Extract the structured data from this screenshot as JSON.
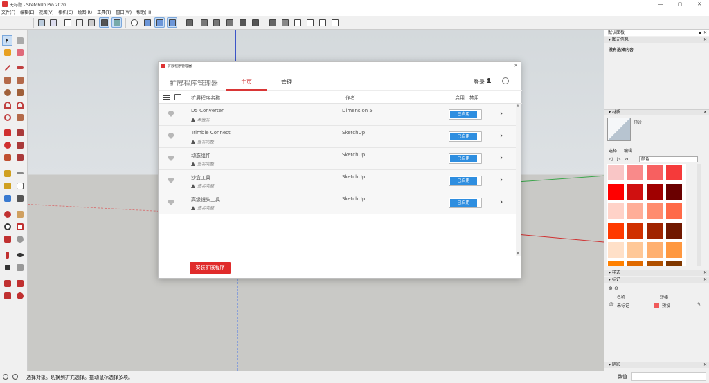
{
  "window": {
    "title": "无标题 - SketchUp Pro 2020",
    "controls": [
      "—",
      "▢",
      "✕"
    ]
  },
  "menu": [
    "文件(F)",
    "编辑(E)",
    "视图(V)",
    "相机(C)",
    "绘图(R)",
    "工具(T)",
    "窗口(W)",
    "帮助(H)"
  ],
  "dialog": {
    "title": "扩展程序管理器",
    "close": "✕",
    "app_name": "扩展程序管理器",
    "tabs": [
      "主页",
      "管理"
    ],
    "active_tab": "主页",
    "login": "登录",
    "columns": {
      "name": "扩展程序名称",
      "author": "作者",
      "status": "启用 | 禁用"
    },
    "extensions": [
      {
        "name": "D5 Converter",
        "signature": "未签名",
        "author": "Dimension 5",
        "state": "已启用"
      },
      {
        "name": "Trimble Connect",
        "signature": "签名完整",
        "author": "SketchUp",
        "state": "已启用"
      },
      {
        "name": "动态组件",
        "signature": "签名完整",
        "author": "SketchUp",
        "state": "已启用"
      },
      {
        "name": "沙盒工具",
        "signature": "签名完整",
        "author": "SketchUp",
        "state": "已启用"
      },
      {
        "name": "高级镜头工具",
        "signature": "签名完整",
        "author": "SketchUp",
        "state": "已启用"
      }
    ],
    "install_button": "安装扩展程序"
  },
  "tray": {
    "title": "默认面板",
    "pin": "▪",
    "close": "✕",
    "entity_info": {
      "title": "图元信息",
      "text": "没有选择内容"
    },
    "materials": {
      "title": "材质",
      "name": "预设",
      "tabs": [
        "选择",
        "编辑"
      ],
      "collection": "颜色",
      "swatches": [
        "#f9c6c6",
        "#f98a8a",
        "#f76060",
        "#f53a3a",
        "#ff0000",
        "#d01010",
        "#a00000",
        "#6a0000",
        "#ffd2c8",
        "#ffae98",
        "#ff8c6e",
        "#ff6a48",
        "#ff3a00",
        "#d03000",
        "#a02400",
        "#701800",
        "#ffe0c8",
        "#ffc898",
        "#ffb070",
        "#ff9840",
        "#ff8000",
        "#e06a00",
        "#b05000",
        "#803800"
      ]
    },
    "styles": {
      "title": "样式"
    },
    "tags": {
      "title": "标记",
      "col_name": "名称",
      "col_dash": "短横",
      "row_name": "未标记",
      "row_dash": "预设"
    },
    "shadows": {
      "title": "阴影"
    }
  },
  "status": {
    "message": "选择对象。切换到扩充选择。拖动鼠标选择多项。",
    "measure_label": "数值"
  }
}
